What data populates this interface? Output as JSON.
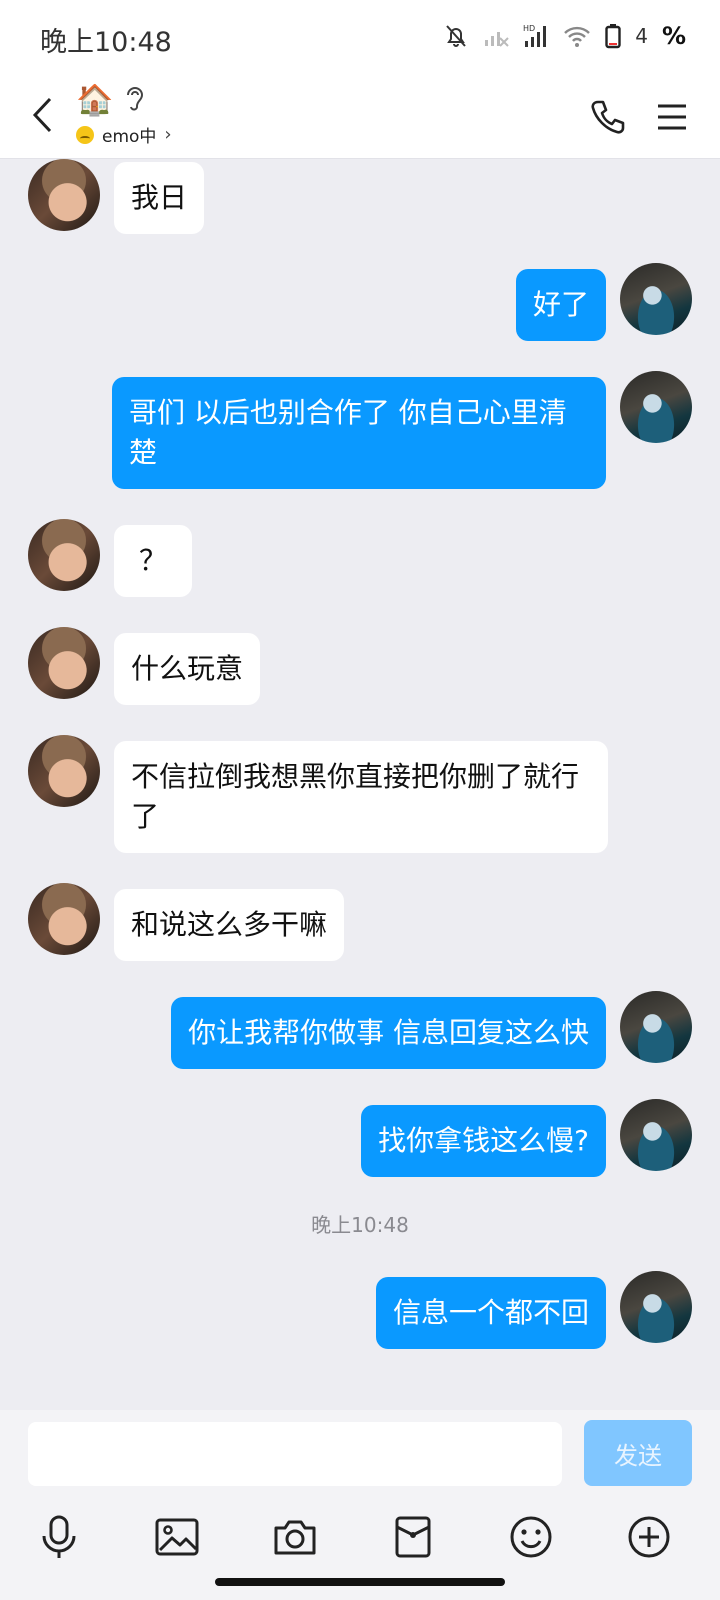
{
  "status_bar": {
    "time": "晚上10:48",
    "battery_level": "4",
    "battery_unit": "%"
  },
  "header": {
    "title_emoji": "🏠",
    "status": "emo中"
  },
  "messages": [
    {
      "side": "in",
      "text": "我日"
    },
    {
      "side": "out",
      "text": "好了"
    },
    {
      "side": "out",
      "text": "哥们 以后也别合作了  你自己心里清楚"
    },
    {
      "side": "in",
      "text": "？"
    },
    {
      "side": "in",
      "text": "什么玩意"
    },
    {
      "side": "in",
      "text": "不信拉倒我想黑你直接把你删了就行了"
    },
    {
      "side": "in",
      "text": "和说这么多干嘛"
    },
    {
      "side": "out",
      "text": "你让我帮你做事 信息回复这么快"
    },
    {
      "side": "out",
      "text": "找你拿钱这么慢?"
    },
    {
      "side": "out",
      "text": "信息一个都不回"
    }
  ],
  "timestamp": "晚上10:48",
  "composer": {
    "input_value": "",
    "send_label": "发送"
  },
  "colors": {
    "outgoing_bubble": "#0a99ff",
    "incoming_bubble": "#ffffff",
    "chat_background": "#ededf2",
    "send_disabled": "#80c6ff"
  },
  "icons": {
    "toolbar": [
      "microphone-icon",
      "image-icon",
      "camera-icon",
      "red-packet-icon",
      "emoji-icon",
      "plus-icon"
    ]
  }
}
